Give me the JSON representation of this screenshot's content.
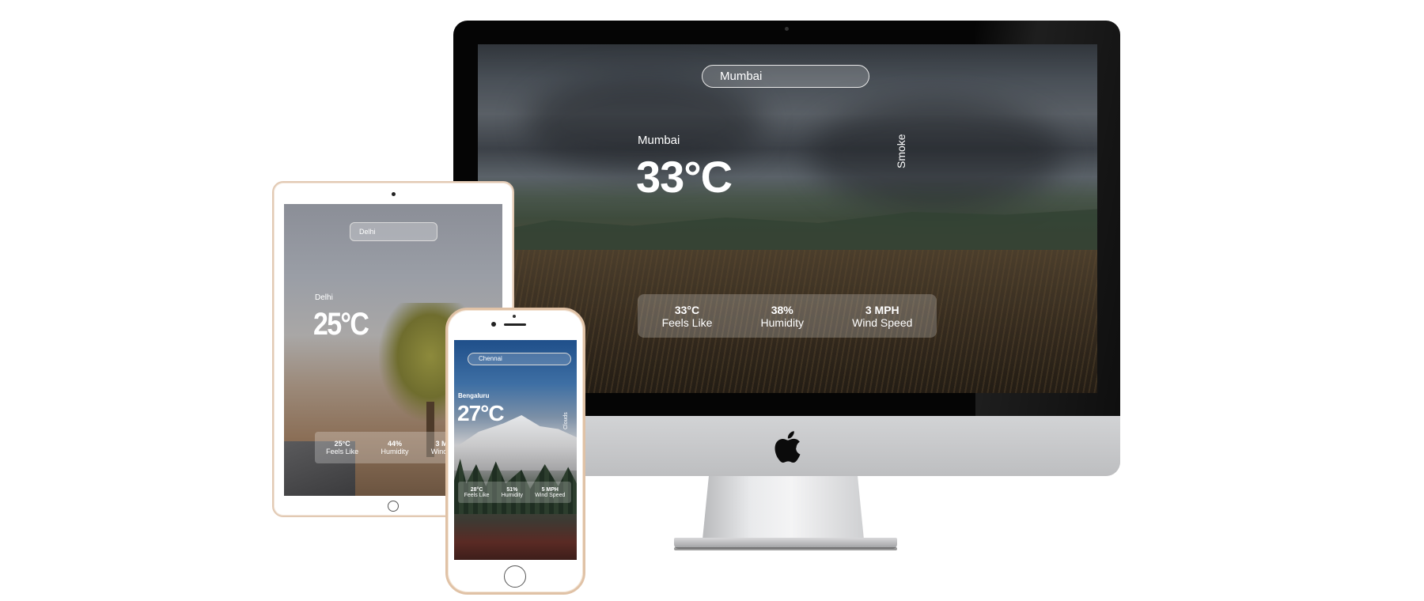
{
  "desktop": {
    "search_value": "Mumbai",
    "city": "Mumbai",
    "temperature": "33°C",
    "description": "Smoke",
    "stats": {
      "feels_like_value": "33°C",
      "feels_like_label": "Feels Like",
      "humidity_value": "38%",
      "humidity_label": "Humidity",
      "wind_value": "3 MPH",
      "wind_label": "Wind Speed"
    }
  },
  "tablet": {
    "search_value": "Delhi",
    "city": "Delhi",
    "temperature": "25°C",
    "stats": {
      "feels_like_value": "25°C",
      "feels_like_label": "Feels Like",
      "humidity_value": "44%",
      "humidity_label": "Humidity",
      "wind_value": "3 MPH",
      "wind_label": "Wind Spe"
    }
  },
  "phone": {
    "search_value": "Chennai",
    "city": "Bengaluru",
    "temperature": "27°C",
    "description": "Clouds",
    "stats": {
      "feels_like_value": "28°C",
      "feels_like_label": "Feels Like",
      "humidity_value": "51%",
      "humidity_label": "Humidity",
      "wind_value": "5 MPH",
      "wind_label": "Wind Speed"
    }
  },
  "icons": {
    "brand_logo": "apple-logo-icon"
  }
}
